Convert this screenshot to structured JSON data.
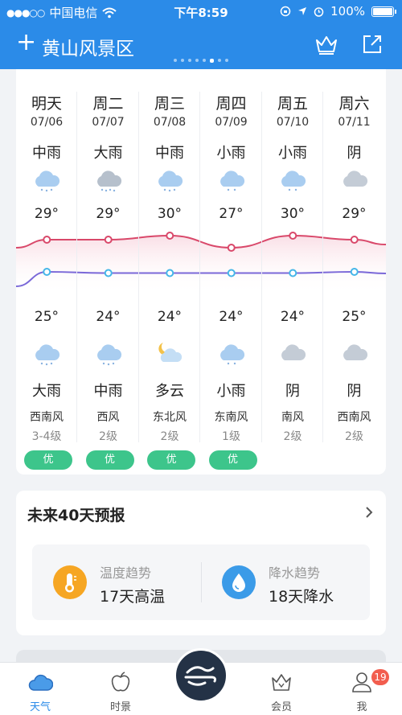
{
  "status_bar": {
    "carrier": "中国电信",
    "time": "下午8:59",
    "battery": "100%"
  },
  "header": {
    "add_label": "+",
    "title": "黄山风景区",
    "page_count": 8,
    "active_page": 5
  },
  "forecast": {
    "days": [
      {
        "name": "明天",
        "date": "07/06",
        "day_weather": "中雨",
        "day_icon": "rain-cloud-icon",
        "high": "29°",
        "high_value": 29,
        "low": "25°",
        "low_value": 25,
        "night_icon": "rain-cloud-icon",
        "night_weather": "大雨",
        "wind_dir": "西南风",
        "wind_level": "3-4级",
        "aqi": "优"
      },
      {
        "name": "周二",
        "date": "07/07",
        "day_weather": "大雨",
        "day_icon": "heavy-rain-cloud-icon",
        "high": "29°",
        "high_value": 29,
        "low": "24°",
        "low_value": 24,
        "night_icon": "rain-cloud-icon",
        "night_weather": "中雨",
        "wind_dir": "西风",
        "wind_level": "2级",
        "aqi": "优"
      },
      {
        "name": "周三",
        "date": "07/08",
        "day_weather": "中雨",
        "day_icon": "rain-cloud-icon",
        "high": "30°",
        "high_value": 30,
        "low": "24°",
        "low_value": 24,
        "night_icon": "moon-cloud-icon",
        "night_weather": "多云",
        "wind_dir": "东北风",
        "wind_level": "2级",
        "aqi": "优"
      },
      {
        "name": "周四",
        "date": "07/09",
        "day_weather": "小雨",
        "day_icon": "light-rain-cloud-icon",
        "high": "27°",
        "high_value": 27,
        "low": "24°",
        "low_value": 24,
        "night_icon": "light-rain-cloud-icon",
        "night_weather": "小雨",
        "wind_dir": "东南风",
        "wind_level": "1级",
        "aqi": "优"
      },
      {
        "name": "周五",
        "date": "07/10",
        "day_weather": "小雨",
        "day_icon": "light-rain-cloud-icon",
        "high": "30°",
        "high_value": 30,
        "low": "24°",
        "low_value": 24,
        "night_icon": "overcast-cloud-icon",
        "night_weather": "阴",
        "wind_dir": "南风",
        "wind_level": "2级",
        "aqi": ""
      },
      {
        "name": "周六",
        "date": "07/11",
        "day_weather": "阴",
        "day_icon": "overcast-cloud-icon",
        "high": "29°",
        "high_value": 29,
        "low": "25°",
        "low_value": 25,
        "night_icon": "overcast-cloud-icon",
        "night_weather": "阴",
        "wind_dir": "西南风",
        "wind_level": "2级",
        "aqi": ""
      }
    ]
  },
  "outlook": {
    "title": "未来40天预报",
    "temp_label": "温度趋势",
    "temp_value": "17天高温",
    "rain_label": "降水趋势",
    "rain_value": "18天降水"
  },
  "tabbar": {
    "weather": "天气",
    "scenery": "时景",
    "member": "会员",
    "me": "我",
    "badge": "19"
  },
  "colors": {
    "brand": "#2b8be8",
    "high_line": "#d9486a",
    "low_line": "#7a68d8",
    "aqi_good": "#3dc58b",
    "badge": "#f25d4e"
  }
}
